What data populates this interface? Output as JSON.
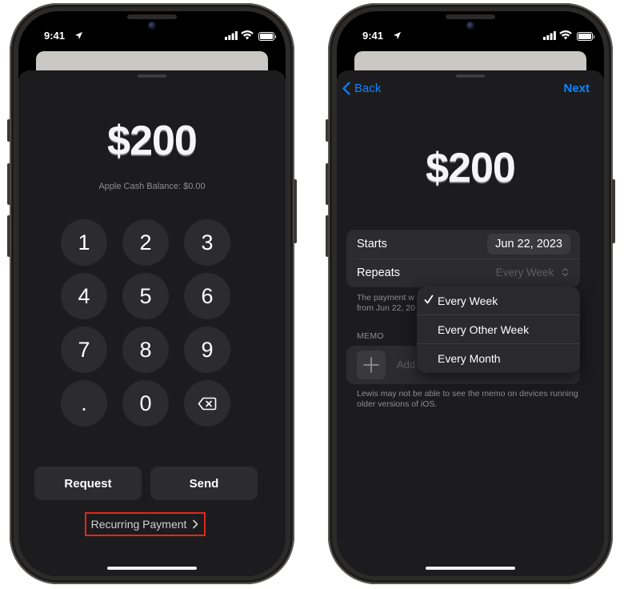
{
  "status_bar": {
    "time": "9:41"
  },
  "left_screen": {
    "amount": "$200",
    "balance_text": "Apple Cash Balance: $0.00",
    "keys": [
      "1",
      "2",
      "3",
      "4",
      "5",
      "6",
      "7",
      "8",
      "9",
      ".",
      "0"
    ],
    "request_label": "Request",
    "send_label": "Send",
    "recurring_label": "Recurring Payment",
    "highlight_color": "#e0281c"
  },
  "right_screen": {
    "back_label": "Back",
    "next_label": "Next",
    "amount": "$200",
    "starts_label": "Starts",
    "starts_date": "Jun 22, 2023",
    "repeats_label": "Repeats",
    "repeats_value": "Every Week",
    "note_visible": "The payment w from Jun 22, 20",
    "memo_label": "MEMO",
    "memo_placeholder": "Add",
    "memo_note": "Lewis may not be able to see the memo on devices running older versions of iOS.",
    "dropdown_options": [
      {
        "label": "Every Week",
        "selected": true
      },
      {
        "label": "Every Other Week",
        "selected": false
      },
      {
        "label": "Every Month",
        "selected": false
      }
    ],
    "accent_color": "#0a84ff"
  }
}
